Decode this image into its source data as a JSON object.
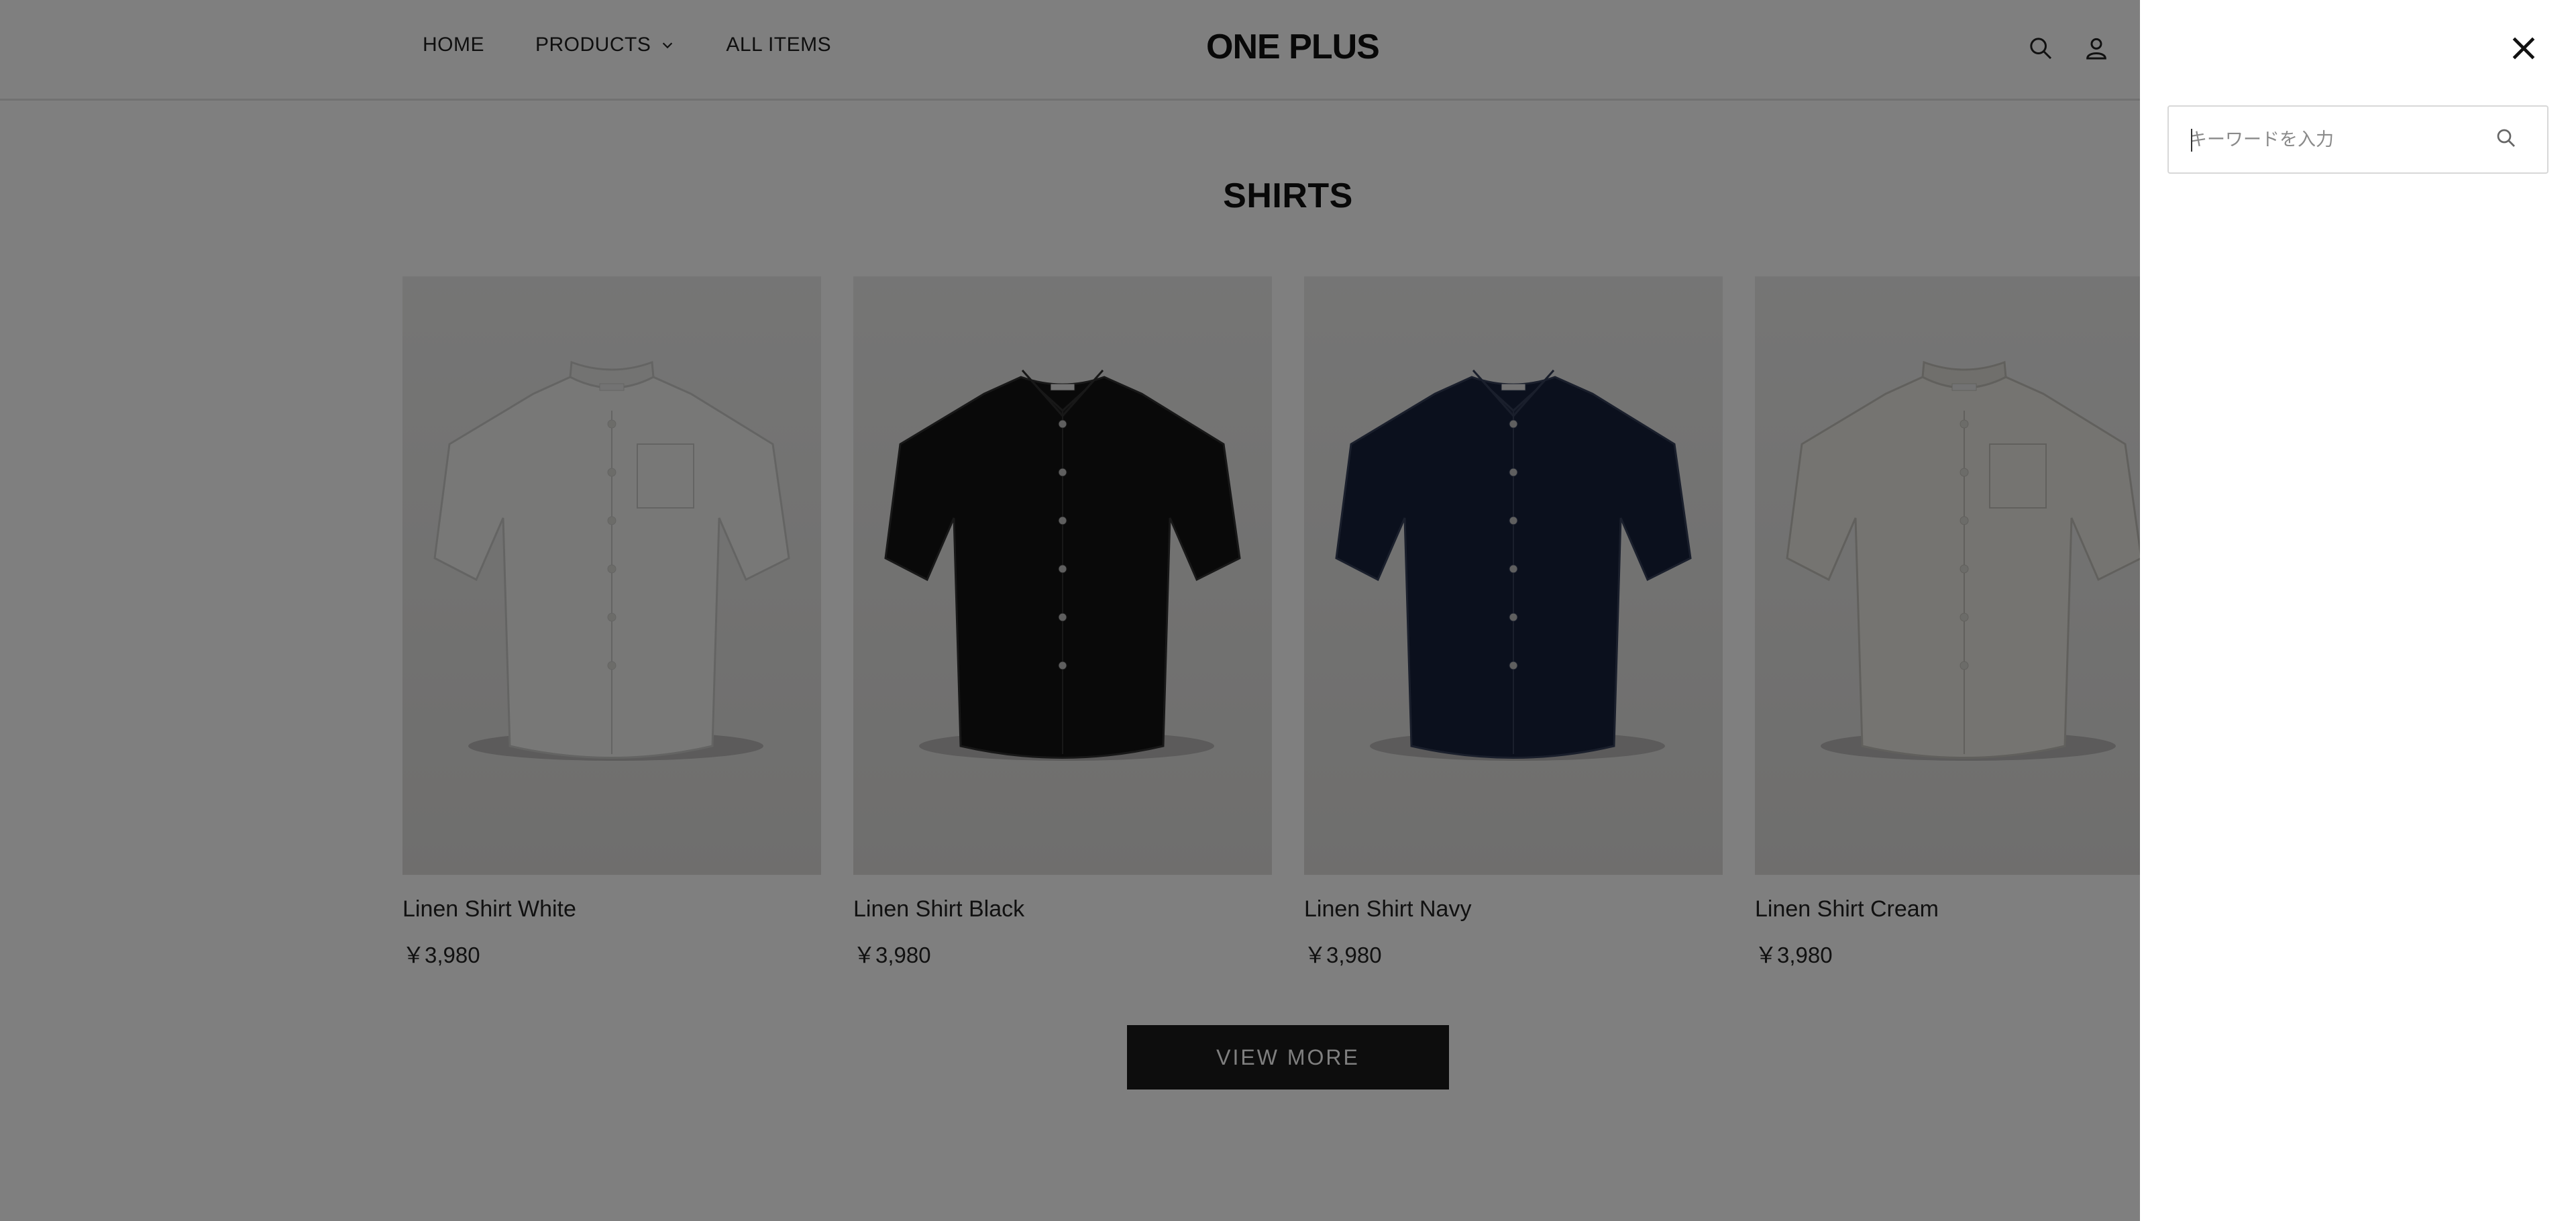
{
  "header": {
    "nav": [
      {
        "label": "HOME"
      },
      {
        "label": "PRODUCTS"
      },
      {
        "label": "ALL ITEMS"
      }
    ],
    "logo": "ONE PLUS",
    "icons": [
      "search-icon",
      "user-icon"
    ]
  },
  "section": {
    "title": "SHIRTS"
  },
  "products": [
    {
      "name": "Linen Shirt White",
      "price": "￥3,980",
      "color": "#f1f1ef",
      "collar_band": true
    },
    {
      "name": "Linen Shirt Black",
      "price": "￥3,980",
      "color": "#121212",
      "collar_band": false
    },
    {
      "name": "Linen Shirt Navy",
      "price": "￥3,980",
      "color": "#16203a",
      "collar_band": false
    },
    {
      "name": "Linen Shirt Cream",
      "price": "￥3,980",
      "color": "#ebe9e2",
      "collar_band": true
    }
  ],
  "view_more": {
    "label": "VIEW MORE"
  },
  "search_drawer": {
    "placeholder": "キーワードを入力",
    "icons": [
      "close-icon",
      "search-icon"
    ]
  },
  "colors": {
    "overlay": "rgba(0,0,0,0.5)",
    "button_bg": "#1b1b1b",
    "drawer_bg": "#ffffff"
  }
}
